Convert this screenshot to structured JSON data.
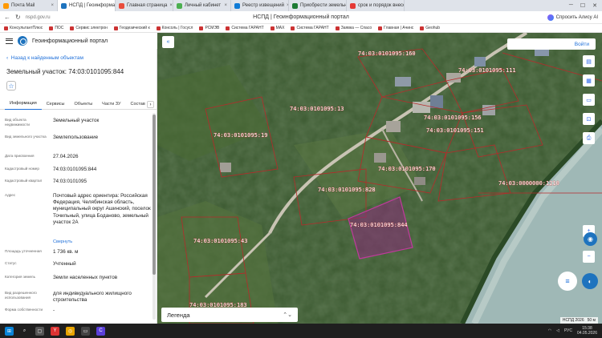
{
  "browser": {
    "tabs": [
      {
        "label": "Почта Mail",
        "color": "#ff9900"
      },
      {
        "label": "НСПД | Геоинформационный п",
        "color": "#1e73be",
        "active": true
      },
      {
        "label": "Главная страница",
        "color": "#e94c3c"
      },
      {
        "label": "Личный кабинет",
        "color": "#4caf50"
      },
      {
        "label": "Реестр извещений",
        "color": "#0f7bd6"
      },
      {
        "label": "Приобрести земельный",
        "color": "#1e7b34"
      },
      {
        "label": "срок и порядок внесения",
        "color": "#e53935"
      }
    ],
    "url": "nspd.gov.ru",
    "page_title": "НСПД | Геоинформационный портал",
    "alice_label": "Спросить Алису AI",
    "bookmarks": [
      "КонсультантПлюс",
      "ПОС",
      "Сервис электрон",
      "Геодезический к",
      "Консоль | Госусл",
      "РСМЭВ",
      "Система ГАРАНТ",
      "MAX",
      "Система ГАРАНТ",
      "Заявка — Спасо",
      "Главная | Ачинс",
      "Geohub"
    ]
  },
  "portal": {
    "name": "Геоинформационный портал",
    "back_link": "Назад к найденным объектам",
    "title": "Земельный участок: 74:03:0101095:844",
    "tabs": [
      "Информация",
      "Сервисы",
      "Объекты",
      "Части ЗУ",
      "Состав"
    ],
    "fields": [
      {
        "label": "Вид объекта недвижимости",
        "value": "Земельный участок"
      },
      {
        "label": "Вид земельного участка",
        "value": "Землепользование"
      },
      {
        "label": "Дата присвоения",
        "value": "27.04.2026"
      },
      {
        "label": "Кадастровый номер",
        "value": "74:03:0101095:844"
      },
      {
        "label": "Кадастровый квартал",
        "value": "74:03:0101095"
      },
      {
        "label": "Адрес",
        "value": "Почтовый адрес ориентира: Российская Федерация, Челябинская область, муниципальный округ Ашинский, поселок Точильный, улица Боданово, земельный участок 2А",
        "link": "Свернуть"
      },
      {
        "label": "Площадь уточненная",
        "value": "1 736 кв. м"
      },
      {
        "label": "Статус",
        "value": "Учтенный"
      },
      {
        "label": "Категория земель",
        "value": "Земли населенных пунктов"
      },
      {
        "label": "Вид разрешенного использования",
        "value": "для индивидуального жилищного строительства"
      },
      {
        "label": "Форма собственности",
        "value": "-"
      }
    ]
  },
  "map": {
    "login": "Войти",
    "legend": "Легенда",
    "attribution": "НСПД 2026",
    "scale": "50 м",
    "labels": [
      "74:03:0101095:160",
      "74:03:0101095:111",
      "74:03:0101095:13",
      "74:03:0101095:156",
      "74:03:0101095:151",
      "74:03:0101095:19",
      "74:03:0101095:170",
      "74:03:0101095:828",
      "74:03:0000000:1210",
      "74:03:0101095:844",
      "74:03:0101095:43",
      "74:03:0101095:183"
    ]
  },
  "taskbar": {
    "lang": "РУС",
    "time": "15:38",
    "date": "04.05.2026"
  }
}
